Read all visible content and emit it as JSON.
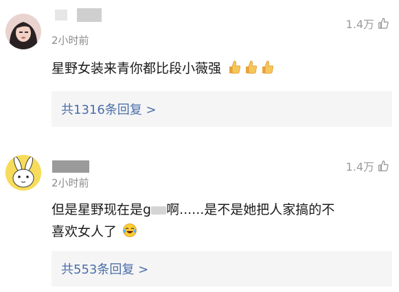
{
  "comments": [
    {
      "time": "2小时前",
      "likes": "1.4万",
      "content": "星野女装来青你都比段小薇强",
      "replies": "共1316条回复 >",
      "avatar": "avatar-photo",
      "emojis": [
        "thumbs-up-emoji",
        "thumbs-up-emoji",
        "thumbs-up-emoji"
      ]
    },
    {
      "time": "2小时前",
      "likes": "1.4万",
      "content_a": "但是星野现在是g",
      "content_b": "啊......是不是她把人家搞的不",
      "content_c": "喜欢女人了",
      "replies": "共553条回复 >",
      "avatar": "avatar-cartoon-rabbit",
      "emojis": [
        "laugh-cry-emoji"
      ]
    }
  ],
  "colors": {
    "link": "#4a6ea8",
    "meta": "#8a8a8a",
    "reply_bg": "#f5f5f5"
  }
}
